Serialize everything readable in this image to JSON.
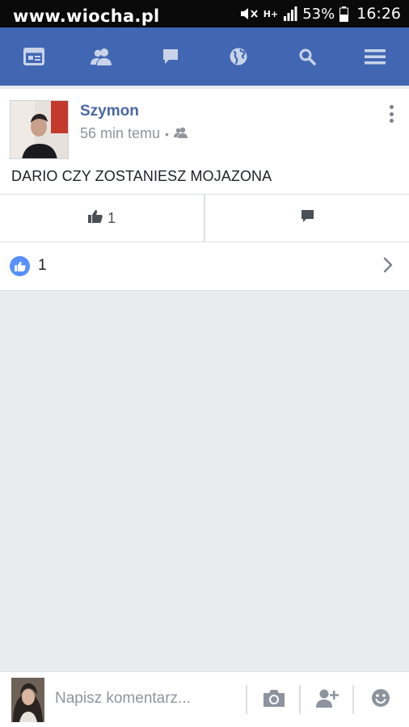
{
  "status_bar": {
    "watermark": "www.wiocha.pl",
    "network_label": "H+",
    "battery_percent": "53%",
    "time": "16:26"
  },
  "nav": {
    "items": [
      {
        "icon": "news-feed-icon"
      },
      {
        "icon": "friends-icon"
      },
      {
        "icon": "messages-icon"
      },
      {
        "icon": "notifications-globe-icon"
      },
      {
        "icon": "search-icon"
      },
      {
        "icon": "menu-icon"
      }
    ],
    "bar_color": "#4267b2"
  },
  "post": {
    "author": "Szymon",
    "time_ago": "56 min temu",
    "separator": "•",
    "audience_icon": "friends-icon",
    "text": "DARIO CZY ZOSTANIESZ MOJAZONA",
    "like_button_count": "1",
    "likes_total": "1",
    "like_badge_color": "#5890ff"
  },
  "comment_bar": {
    "placeholder": "Napisz komentarz..."
  }
}
